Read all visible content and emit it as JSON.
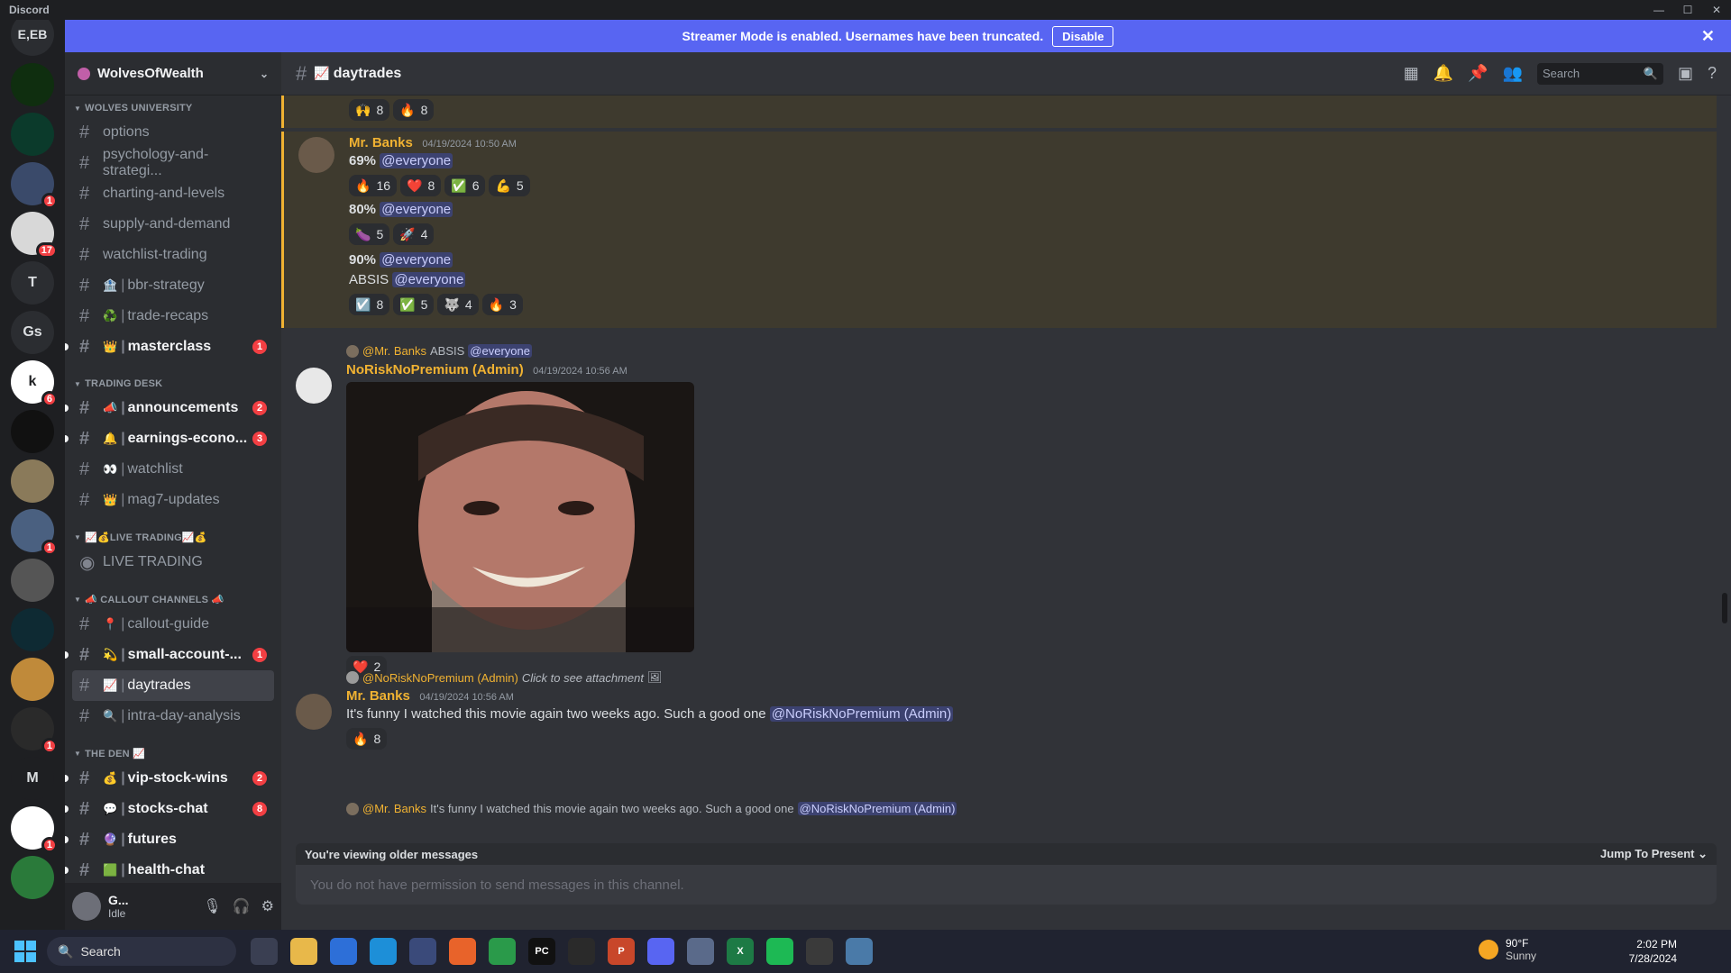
{
  "app_title": "Discord",
  "window_controls": {
    "minimize": "—",
    "maximize": "☐",
    "close": "✕"
  },
  "banner": {
    "text": "Streamer Mode is enabled. Usernames have been truncated.",
    "button": "Disable",
    "close": "✕"
  },
  "rail": {
    "top_label": "E,EB",
    "servers": [
      {
        "label": "",
        "badge": "",
        "color": "#0f2e0f"
      },
      {
        "label": "",
        "badge": "",
        "color": "#0b3a2b"
      },
      {
        "label": "",
        "badge": "1",
        "color": "#3a4a6a"
      },
      {
        "label": "",
        "badge": "17",
        "color": "#d8d8d8"
      },
      {
        "label": "T",
        "badge": "",
        "color": "#2b2d31"
      },
      {
        "label": "Gs",
        "badge": "",
        "color": "#2b2d31"
      },
      {
        "label": "k",
        "badge": "6",
        "color": "#ffffff"
      },
      {
        "label": "",
        "badge": "",
        "color": "#111111"
      },
      {
        "label": "",
        "badge": "",
        "color": "#8a7a5a"
      },
      {
        "label": "",
        "badge": "1",
        "color": "#4a6080"
      },
      {
        "label": "",
        "badge": "",
        "color": "#555555"
      },
      {
        "label": "",
        "badge": "",
        "color": "#0e2a33"
      },
      {
        "label": "",
        "badge": "",
        "color": "#c08a3a"
      },
      {
        "label": "",
        "badge": "1",
        "color": "#2a2a2a"
      },
      {
        "label": "M",
        "badge": "",
        "color": "#1e1f22"
      },
      {
        "label": "",
        "badge": "1",
        "color": "#ffffff"
      },
      {
        "label": "",
        "badge": "",
        "color": "#2a7a3a"
      }
    ]
  },
  "guild": {
    "name": "WolvesOfWealth"
  },
  "categories": [
    {
      "name": "WOLVES UNIVERSITY",
      "channels": [
        {
          "emoji": "",
          "name": "options",
          "unread": false,
          "badge": ""
        },
        {
          "emoji": "",
          "name": "psychology-and-strategi...",
          "unread": false,
          "badge": ""
        },
        {
          "emoji": "",
          "name": "charting-and-levels",
          "unread": false,
          "badge": ""
        },
        {
          "emoji": "",
          "name": "supply-and-demand",
          "unread": false,
          "badge": ""
        },
        {
          "emoji": "",
          "name": "watchlist-trading",
          "unread": false,
          "badge": ""
        },
        {
          "emoji": "🏦",
          "name": "bbr-strategy",
          "unread": false,
          "badge": ""
        },
        {
          "emoji": "♻️",
          "name": "trade-recaps",
          "unread": false,
          "badge": ""
        },
        {
          "emoji": "👑",
          "name": "masterclass",
          "unread": true,
          "badge": "1"
        }
      ]
    },
    {
      "name": "TRADING DESK",
      "channels": [
        {
          "emoji": "📣",
          "name": "announcements",
          "unread": true,
          "badge": "2"
        },
        {
          "emoji": "🔔",
          "name": "earnings-econo...",
          "unread": true,
          "badge": "3"
        },
        {
          "emoji": "👀",
          "name": "watchlist",
          "unread": false,
          "badge": ""
        },
        {
          "emoji": "👑",
          "name": "mag7-updates",
          "unread": false,
          "badge": ""
        }
      ]
    },
    {
      "name": "📈💰LIVE TRADING📈💰",
      "voice": "LIVE TRADING"
    },
    {
      "name": "📣 CALLOUT CHANNELS 📣",
      "channels": [
        {
          "emoji": "📍",
          "name": "callout-guide",
          "unread": false,
          "badge": ""
        },
        {
          "emoji": "💫",
          "name": "small-account-...",
          "unread": true,
          "badge": "1"
        },
        {
          "emoji": "📈",
          "name": "daytrades",
          "unread": false,
          "badge": "",
          "active": true
        },
        {
          "emoji": "🔍",
          "name": "intra-day-analysis",
          "unread": false,
          "badge": ""
        }
      ]
    },
    {
      "name": "THE DEN 📈",
      "channels": [
        {
          "emoji": "💰",
          "name": "vip-stock-wins",
          "unread": true,
          "badge": "2"
        },
        {
          "emoji": "💬",
          "name": "stocks-chat",
          "unread": true,
          "badge": "8"
        },
        {
          "emoji": "🔮",
          "name": "futures",
          "unread": true,
          "badge": ""
        },
        {
          "emoji": "🟩",
          "name": "health-chat",
          "unread": true,
          "badge": ""
        }
      ]
    }
  ],
  "user": {
    "name": "G...",
    "status": "Idle"
  },
  "header": {
    "channel": "daytrades",
    "search_placeholder": "Search"
  },
  "messages": {
    "top_reactions": [
      {
        "emoji": "🙌",
        "count": "8"
      },
      {
        "emoji": "🔥",
        "count": "8"
      }
    ],
    "m1": {
      "author": "Mr. Banks",
      "time": "04/19/2024 10:50 AM",
      "l1": "69%",
      "l2": "80%",
      "l3": "90%",
      "l4": "ABSIS",
      "mention": "@everyone",
      "r1": [
        {
          "emoji": "🔥",
          "count": "16"
        },
        {
          "emoji": "❤️",
          "count": "8"
        },
        {
          "emoji": "✅",
          "count": "6"
        },
        {
          "emoji": "💪",
          "count": "5"
        }
      ],
      "r2": [
        {
          "emoji": "🍆",
          "count": "5"
        },
        {
          "emoji": "🚀",
          "count": "4"
        }
      ],
      "r3": [
        {
          "emoji": "☑️",
          "count": "8"
        },
        {
          "emoji": "✅",
          "count": "5"
        },
        {
          "emoji": "🐺",
          "count": "4"
        },
        {
          "emoji": "🔥",
          "count": "3"
        }
      ]
    },
    "m2": {
      "reply_author": "@Mr. Banks",
      "reply_text": "ABSIS",
      "reply_mention": "@everyone",
      "author": "NoRiskNoPremium (Admin)",
      "time": "04/19/2024 10:56 AM",
      "r": [
        {
          "emoji": "❤️",
          "count": "2"
        }
      ]
    },
    "m3": {
      "reply_author": "@NoRiskNoPremium (Admin)",
      "reply_text": "Click to see attachment",
      "author": "Mr. Banks",
      "time": "04/19/2024 10:56 AM",
      "text": "It's funny I watched this movie again two weeks ago. Such a good one",
      "mention": "@NoRiskNoPremium (Admin)",
      "r": [
        {
          "emoji": "🔥",
          "count": "8"
        }
      ]
    },
    "m4": {
      "reply_author": "@Mr. Banks",
      "reply_text": "It's funny I watched this movie again two weeks ago. Such a good one",
      "reply_mention": "@NoRiskNoPremium (Admin)"
    }
  },
  "older_bar": {
    "text": "You're viewing older messages",
    "jump": "Jump To Present ⌄"
  },
  "composer": {
    "placeholder": "You do not have permission to send messages in this channel."
  },
  "taskbar": {
    "search": "Search",
    "apps": [
      {
        "icon": "task-view-icon",
        "label": "",
        "color": "#3a3f52"
      },
      {
        "icon": "file-explorer-icon",
        "label": "",
        "color": "#e8b84a"
      },
      {
        "icon": "store-icon",
        "label": "",
        "color": "#2d6fd8"
      },
      {
        "icon": "edge-icon",
        "label": "",
        "color": "#1d8fd8"
      },
      {
        "icon": "cat-app-icon",
        "label": "",
        "color": "#3a4a7a"
      },
      {
        "icon": "firefox-icon",
        "label": "",
        "color": "#e8632a"
      },
      {
        "icon": "chrome-icon",
        "label": "",
        "color": "#2a9a4a"
      },
      {
        "icon": "pycharm-icon",
        "label": "PC",
        "color": "#111111"
      },
      {
        "icon": "app-icon",
        "label": "",
        "color": "#2a2a2a"
      },
      {
        "icon": "powerpoint-icon",
        "label": "P",
        "color": "#c8472a"
      },
      {
        "icon": "discord-icon",
        "label": "",
        "color": "#5865f2"
      },
      {
        "icon": "snip-icon",
        "label": "",
        "color": "#5a6a8a"
      },
      {
        "icon": "excel-icon",
        "label": "X",
        "color": "#1d7a45"
      },
      {
        "icon": "spotify-icon",
        "label": "",
        "color": "#1db954"
      },
      {
        "icon": "obs-icon",
        "label": "",
        "color": "#3a3a3a"
      },
      {
        "icon": "photos-icon",
        "label": "",
        "color": "#4a7aa8"
      }
    ],
    "weather_temp": "90°F",
    "weather_cond": "Sunny",
    "time": "2:02 PM",
    "date": "7/28/2024"
  }
}
